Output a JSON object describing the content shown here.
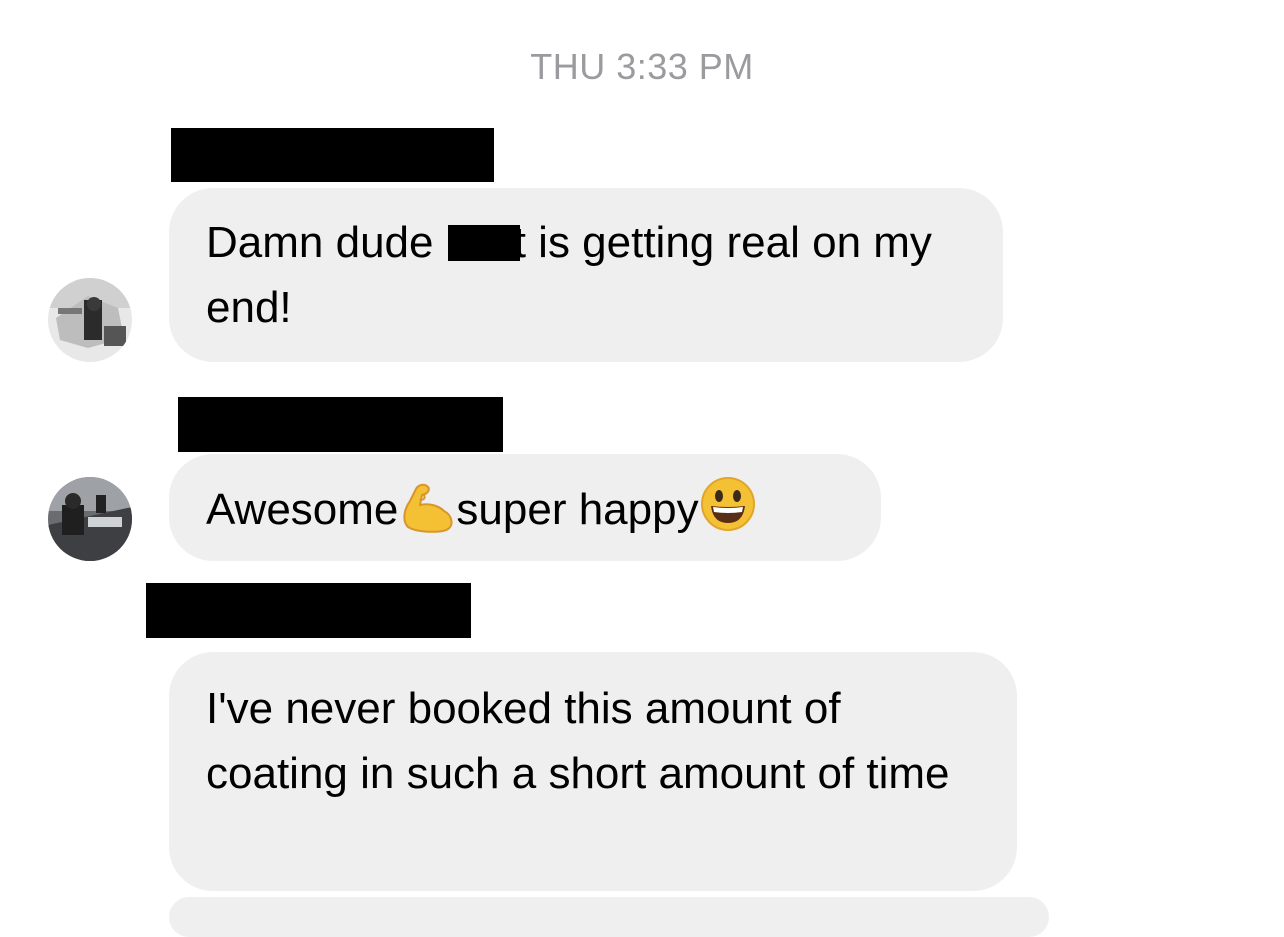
{
  "thread": {
    "timestamp": "THU 3:33 PM"
  },
  "messages": [
    {
      "text_before": "Damn dude",
      "text_after": "t is getting real on my end!"
    },
    {
      "text_before": "Awesome",
      "text_after": "super happy",
      "emojis": [
        "flexed-biceps-emoji",
        "grinning-face-emoji"
      ]
    },
    {
      "text": "I've never booked this amount of coating in such a short amount of time"
    }
  ],
  "colors": {
    "bubble": "#efefef",
    "timestamp": "#9b9b9f",
    "redaction": "#000000",
    "emoji_yellow": "#f5c134"
  }
}
